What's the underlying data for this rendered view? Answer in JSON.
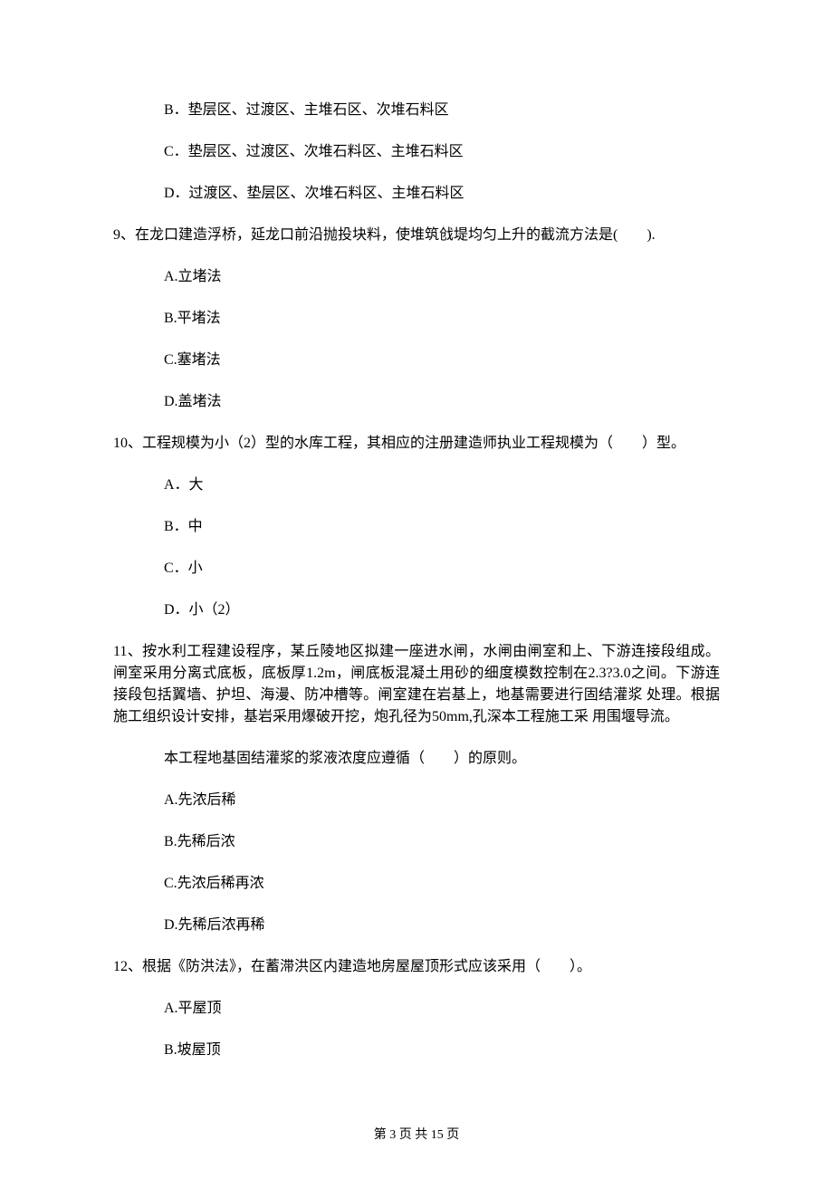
{
  "options_pre": {
    "b": "B．垫层区、过渡区、主堆石区、次堆石料区",
    "c": "C．垫层区、过渡区、次堆石料区、主堆石料区",
    "d": "D．过渡区、垫层区、次堆石料区、主堆石料区"
  },
  "q9": {
    "stem": "9、在龙口建造浮桥，延龙口前沿抛投块料，使堆筑戗堤均匀上升的截流方法是(　　).",
    "a": "A.立堵法",
    "b": "B.平堵法",
    "c": "C.塞堵法",
    "d": "D.盖堵法"
  },
  "q10": {
    "stem": "10、工程规模为小（2）型的水库工程，其相应的注册建造师执业工程规模为（　　）型。",
    "a": "A．大",
    "b": "B．中",
    "c": "C．小",
    "d": "D．小（2）"
  },
  "q11": {
    "stem": "11、按水利工程建设程序，某丘陵地区拟建一座进水闸，水闸由闸室和上、下游连接段组成。闸室采用分离式底板，底板厚1.2m，闸底板混凝土用砂的细度模数控制在2.3?3.0之间。下游连接段包括翼墙、护坦、海漫、防冲槽等。闸室建在岩基上，地基需要进行固结灌浆 处理。根据施工组织设计安排，基岩采用爆破开挖，炮孔径为50mm,孔深本工程施工采 用围堰导流。",
    "sub": "本工程地基固结灌浆的浆液浓度应遵循（　　）的原则。",
    "a": "A.先浓后稀",
    "b": "B.先稀后浓",
    "c": "C.先浓后稀再浓",
    "d": "D.先稀后浓再稀"
  },
  "q12": {
    "stem": "12、根据《防洪法》，在蓄滞洪区内建造地房屋屋顶形式应该采用（　　）。",
    "a": "A.平屋顶",
    "b": "B.坡屋顶"
  },
  "footer": "第 3 页 共 15 页"
}
